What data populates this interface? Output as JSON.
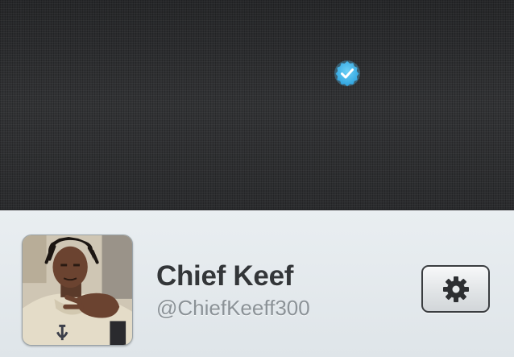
{
  "header": {
    "banner_icon": "verified-badge-icon",
    "badge_color": "#3fb2e8"
  },
  "profile": {
    "display_name": "Chief Keef",
    "screen_name": "@ChiefKeeff300",
    "avatar_icon": "profile-photo"
  },
  "actions": {
    "settings_icon": "gear-icon"
  },
  "colors": {
    "banner_bg": "#2f3032",
    "profile_bg": "#e6ebee",
    "name_text": "#333639",
    "handle_text": "#8b9297"
  }
}
